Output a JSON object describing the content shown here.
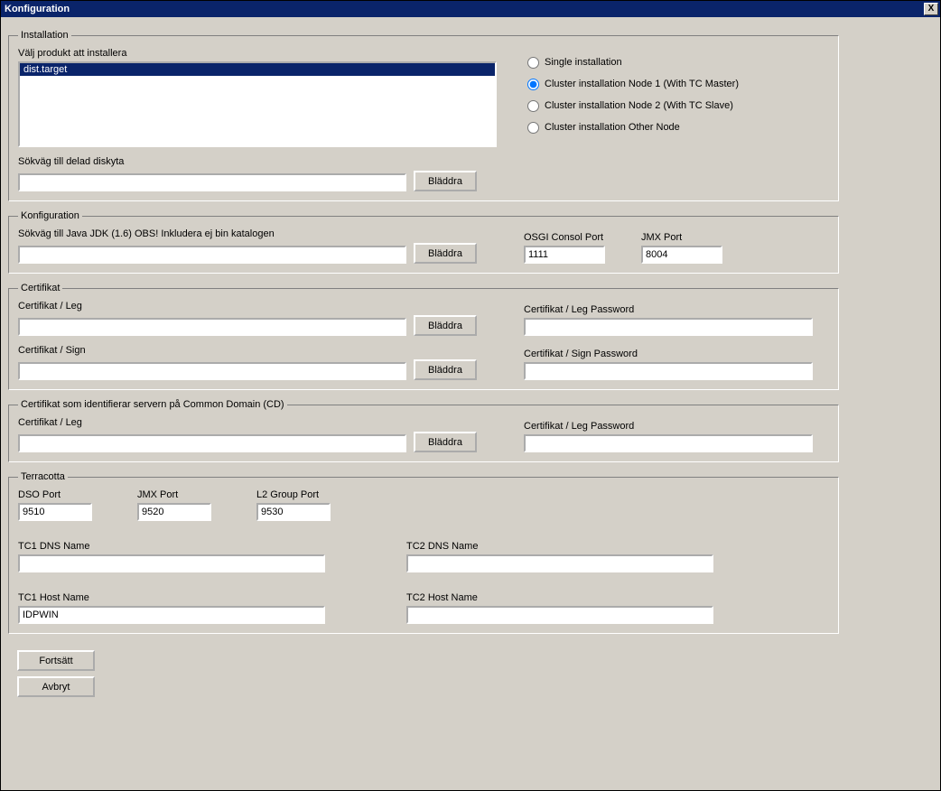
{
  "window": {
    "title": "Konfiguration",
    "close": "X"
  },
  "buttons": {
    "browse": "Bläddra",
    "continue": "Fortsätt",
    "cancel": "Avbryt"
  },
  "installation": {
    "legend": "Installation",
    "choose_product_label": "Välj produkt att installera",
    "list_item": "dist.target",
    "radios": {
      "single": "Single installation",
      "node1": "Cluster installation Node 1 (With TC Master)",
      "node2": "Cluster installation Node 2 (With TC Slave)",
      "other": "Cluster installation Other Node"
    },
    "shared_path_label": "Sökväg till delad diskyta",
    "shared_path_value": ""
  },
  "konfiguration": {
    "legend": "Konfiguration",
    "jdk_label": "Sökväg till Java JDK (1.6) OBS! Inkludera ej bin katalogen",
    "jdk_value": "",
    "osgi_label": "OSGI Consol Port",
    "osgi_value": "1111",
    "jmx_label": "JMX Port",
    "jmx_value": "8004"
  },
  "certifikat": {
    "legend": "Certifikat",
    "leg_label": "Certifikat / Leg",
    "leg_value": "",
    "leg_pw_label": "Certifikat / Leg Password",
    "leg_pw_value": "",
    "sign_label": "Certifikat / Sign",
    "sign_value": "",
    "sign_pw_label": "Certifikat / Sign Password",
    "sign_pw_value": ""
  },
  "cd": {
    "legend": "Certifikat som identifierar servern på Common Domain (CD)",
    "leg_label": "Certifikat / Leg",
    "leg_value": "",
    "leg_pw_label": "Certifikat / Leg Password",
    "leg_pw_value": ""
  },
  "terracotta": {
    "legend": "Terracotta",
    "dso_label": "DSO Port",
    "dso_value": "9510",
    "jmx_label": "JMX Port",
    "jmx_value": "9520",
    "l2_label": "L2 Group Port",
    "l2_value": "9530",
    "tc1dns_label": "TC1 DNS Name",
    "tc1dns_value": "",
    "tc2dns_label": "TC2 DNS Name",
    "tc2dns_value": "",
    "tc1host_label": "TC1 Host Name",
    "tc1host_value": "IDPWIN",
    "tc2host_label": "TC2 Host Name",
    "tc2host_value": ""
  }
}
